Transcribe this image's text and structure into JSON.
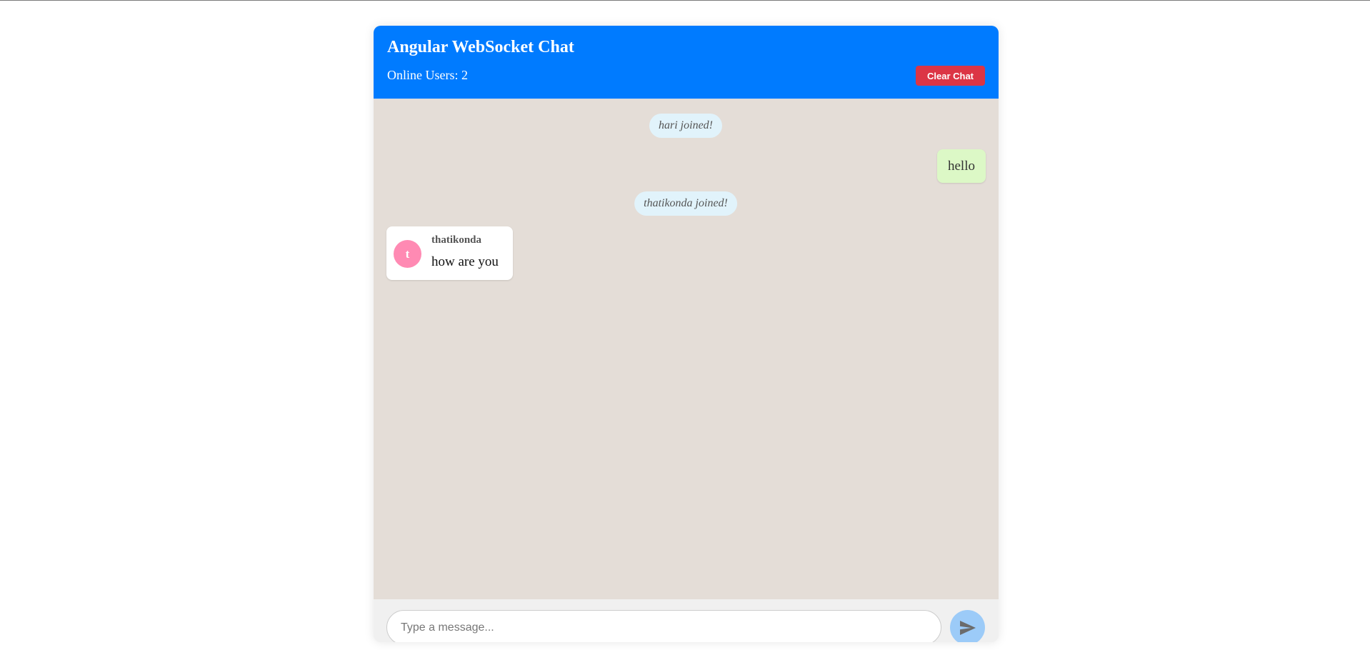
{
  "header": {
    "title": "Angular WebSocket Chat",
    "online_users": "Online Users: 2",
    "clear_label": "Clear Chat"
  },
  "messages": [
    {
      "type": "system",
      "text": "hari joined!"
    },
    {
      "type": "own",
      "text": "hello"
    },
    {
      "type": "system",
      "text": "thatikonda joined!"
    },
    {
      "type": "incoming",
      "sender": "thatikonda",
      "avatar_initial": "t",
      "avatar_color": "#ff8ab3",
      "text": "how are you"
    }
  ],
  "composer": {
    "placeholder": "Type a message...",
    "value": "",
    "send_icon": "send-icon"
  },
  "colors": {
    "header": "#007bff",
    "clear_button": "#dc3545",
    "chat_background": "#e4ddd7",
    "own_bubble": "#dcf8c6",
    "system_bubble": "#e1f3fb",
    "send_button": "#9ccbf8"
  }
}
